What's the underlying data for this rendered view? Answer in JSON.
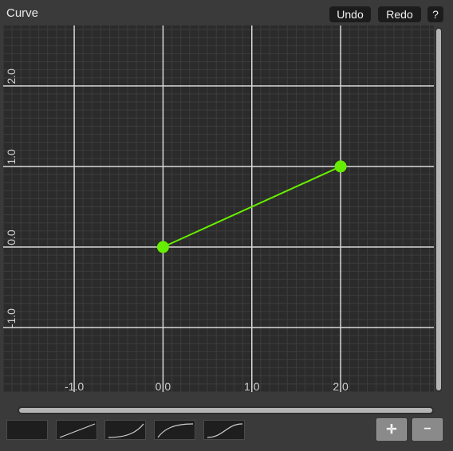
{
  "window": {
    "title": "Curve"
  },
  "toolbar": {
    "undo_label": "Undo",
    "redo_label": "Redo",
    "help_label": "?"
  },
  "curve_editor": {
    "x_ticks": [
      "-1.0",
      "0.0",
      "1.0",
      "2.0"
    ],
    "y_ticks": [
      "2.0",
      "1.0",
      "0.0",
      "-1.0"
    ],
    "x_range": [
      -1.8,
      3.05
    ],
    "y_range": [
      -1.8,
      2.75
    ],
    "points": [
      {
        "x": 0.0,
        "y": 0.0
      },
      {
        "x": 2.0,
        "y": 1.0
      }
    ],
    "curve_color": "#66ee00",
    "point_color": "#66ee00",
    "grid": true
  },
  "presets": [
    {
      "name": "constant-preset-icon",
      "shape": "constant"
    },
    {
      "name": "linear-preset-icon",
      "shape": "linear"
    },
    {
      "name": "ease-in-preset-icon",
      "shape": "ease-in"
    },
    {
      "name": "ease-out-preset-icon",
      "shape": "ease-out"
    },
    {
      "name": "ease-in-out-preset-icon",
      "shape": "ease-in-out"
    }
  ],
  "controls": {
    "add_icon": "add-point-icon",
    "remove_icon": "remove-point-icon",
    "add_glyph": "✛",
    "remove_glyph": "−"
  }
}
